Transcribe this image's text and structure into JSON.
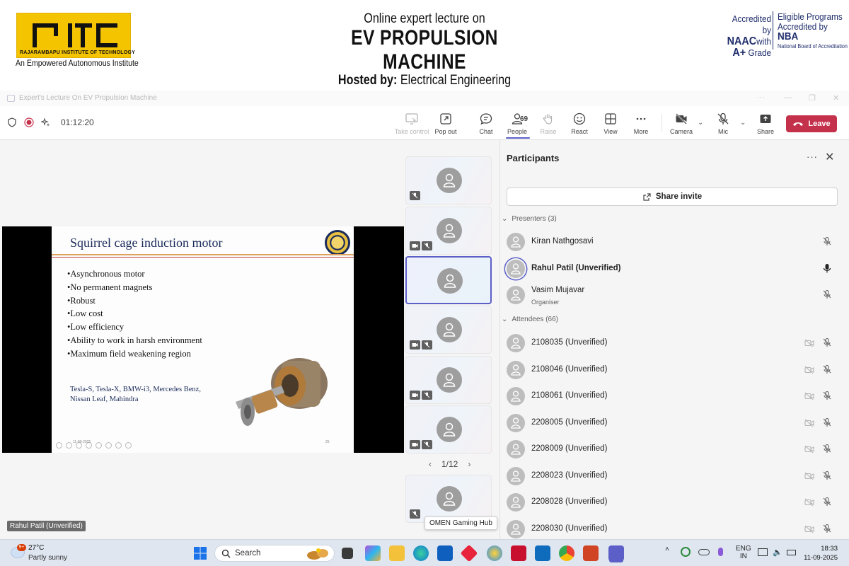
{
  "banner": {
    "institute_name": "RAJARAMBAPU INSTITUTE OF TECHNOLOGY",
    "tagline": "An Empowered Autonomous Institute",
    "line1": "Online expert lecture on",
    "line2": "EV PROPULSION MACHINE",
    "line3_bold": "Hosted by:",
    "line3_rest": " Electrical Engineering",
    "acc_line1": "Accredited by",
    "acc_naac": "NAAC",
    "acc_with": "with",
    "acc_grade": "A+",
    "acc_grade_word": "Grade",
    "acc_r1": "Eligible Programs",
    "acc_r2": "Accredited by",
    "acc_r3": "NBA",
    "acc_r4": "National Board of Accreditation"
  },
  "window": {
    "title": "Expert's Lecture On EV Propulsion Machine",
    "ctrl_more": "···",
    "ctrl_min": "—",
    "ctrl_max": "❐",
    "ctrl_close": "✕"
  },
  "toolbar": {
    "timer": "01:12:20",
    "take_control": "Take control",
    "pop_out": "Pop out",
    "chat": "Chat",
    "people": "People",
    "people_count": "69",
    "raise": "Raise",
    "react": "React",
    "view": "View",
    "more": "More",
    "camera": "Camera",
    "mic": "Mic",
    "share": "Share",
    "leave": "Leave",
    "colors": {
      "accent": "#5b5fc7",
      "leave": "#c4314b"
    }
  },
  "slide": {
    "title": "Squirrel cage induction motor",
    "bullets": [
      "Asynchronous motor",
      "No permanent magnets",
      "Robust",
      "Low cost",
      "Low efficiency",
      "Ability to work in harsh environment",
      "Maximum field weakening region"
    ],
    "brands_line1": "Tesla-S, Tesla-X, BMW-i3, Mercedes Benz,",
    "brands_line2": "Nissan Leaf, Mahindra",
    "date": "11-09-2025",
    "page": "25"
  },
  "stage": {
    "pager": "1/12",
    "pager_prev": "‹",
    "pager_next": "›",
    "tooltip": "OMEN Gaming Hub",
    "name_tag": "Rahul Patil (Unverified)"
  },
  "participants": {
    "title": "Participants",
    "more": "···",
    "close": "✕",
    "share_invite": "Share invite",
    "presenters_label": "Presenters (3)",
    "attendees_label": "Attendees (66)",
    "presenters": [
      {
        "name": "Kiran Nathgosavi",
        "role": "",
        "mic": "muted"
      },
      {
        "name": "Rahul Patil (Unverified)",
        "role": "",
        "mic": "on"
      },
      {
        "name": "Vasim Mujavar",
        "role": "Organiser",
        "mic": "muted"
      }
    ],
    "attendees": [
      {
        "name": "2108035 (Unverified)"
      },
      {
        "name": "2108046 (Unverified)"
      },
      {
        "name": "2108061 (Unverified)"
      },
      {
        "name": "2208005 (Unverified)"
      },
      {
        "name": "2208009 (Unverified)"
      },
      {
        "name": "2208023 (Unverified)"
      },
      {
        "name": "2208028 (Unverified)"
      },
      {
        "name": "2208030 (Unverified)"
      }
    ]
  },
  "taskbar": {
    "weather_badge": "9+",
    "temperature": "27°C",
    "condition": "Partly sunny",
    "search": "Search",
    "lang1": "ENG",
    "lang2": "IN",
    "time": "18:33",
    "date": "11-09-2025"
  }
}
